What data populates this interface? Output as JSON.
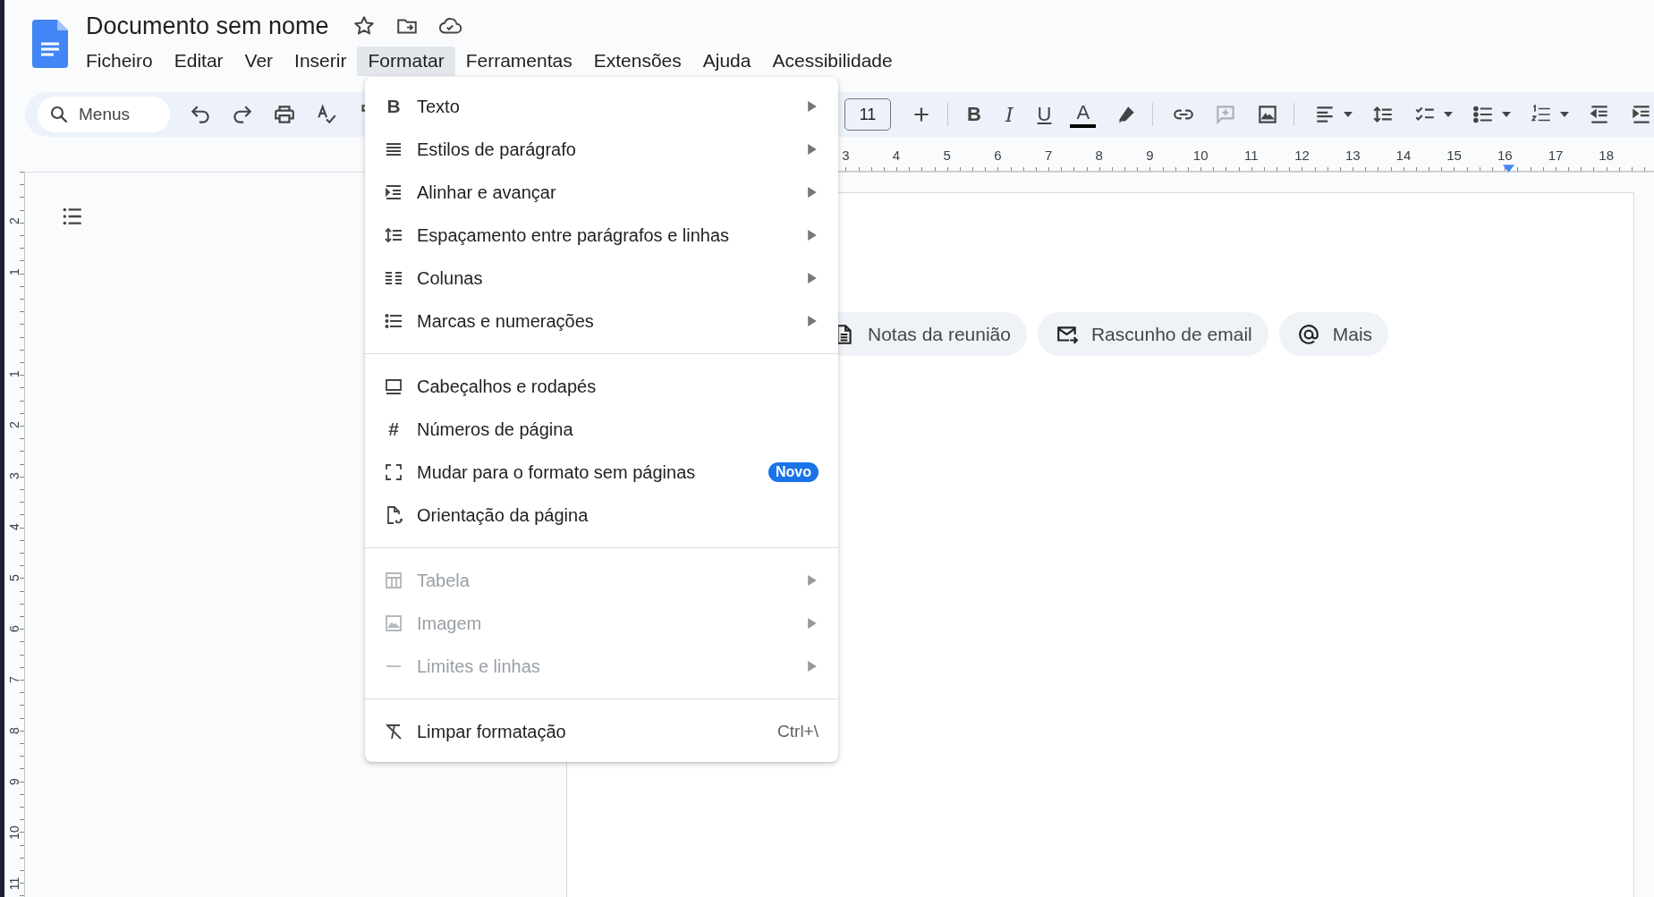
{
  "document": {
    "title": "Documento sem nome"
  },
  "menubar": [
    {
      "label": "Ficheiro",
      "selected": false
    },
    {
      "label": "Editar",
      "selected": false
    },
    {
      "label": "Ver",
      "selected": false
    },
    {
      "label": "Inserir",
      "selected": false
    },
    {
      "label": "Formatar",
      "selected": true
    },
    {
      "label": "Ferramentas",
      "selected": false
    },
    {
      "label": "Extensões",
      "selected": false
    },
    {
      "label": "Ajuda",
      "selected": false
    },
    {
      "label": "Acessibilidade",
      "selected": false
    }
  ],
  "toolbar": {
    "search": {
      "placeholder": "Menus"
    },
    "font_size": "11",
    "text_buttons": [
      {
        "glyph": "B",
        "kind": "bold"
      },
      {
        "glyph": "I",
        "kind": "italic"
      },
      {
        "glyph": "U",
        "kind": "underline"
      },
      {
        "glyph": "A",
        "kind": "color"
      }
    ]
  },
  "horizontal_ruler": [
    "3",
    "4",
    "5",
    "6",
    "7",
    "8",
    "9",
    "10",
    "11",
    "12",
    "13",
    "14",
    "15",
    "16",
    "17",
    "18"
  ],
  "vertical_ruler": {
    "above": [
      "2",
      "1"
    ],
    "below": [
      "1",
      "2",
      "3",
      "4",
      "5",
      "6",
      "7",
      "8",
      "9",
      "10",
      "11"
    ]
  },
  "chips": [
    {
      "label": "Notas da reunião"
    },
    {
      "label": "Rascunho de email"
    },
    {
      "label": "Mais"
    }
  ],
  "format_menu": {
    "sections": [
      [
        {
          "label": "Texto",
          "kind": "submenu",
          "disabled": false,
          "glyph": "B"
        },
        {
          "label": "Estilos de parágrafo",
          "kind": "submenu",
          "disabled": false
        },
        {
          "label": "Alinhar e avançar",
          "kind": "submenu",
          "disabled": false
        },
        {
          "label": "Espaçamento entre parágrafos e linhas",
          "kind": "submenu",
          "disabled": false
        },
        {
          "label": "Colunas",
          "kind": "submenu",
          "disabled": false
        },
        {
          "label": "Marcas e numerações",
          "kind": "submenu",
          "disabled": false
        }
      ],
      [
        {
          "label": "Cabeçalhos e rodapés",
          "kind": "action",
          "disabled": false
        },
        {
          "label": "Números de página",
          "kind": "action",
          "disabled": false,
          "glyph": "#"
        },
        {
          "label": "Mudar para o formato sem páginas",
          "kind": "action",
          "disabled": false,
          "badge": "Novo"
        },
        {
          "label": "Orientação da página",
          "kind": "action",
          "disabled": false
        }
      ],
      [
        {
          "label": "Tabela",
          "kind": "submenu",
          "disabled": true
        },
        {
          "label": "Imagem",
          "kind": "submenu",
          "disabled": true
        },
        {
          "label": "Limites e linhas",
          "kind": "submenu",
          "disabled": true
        }
      ],
      [
        {
          "label": "Limpar formatação",
          "kind": "action",
          "disabled": false,
          "shortcut": "Ctrl+\\"
        }
      ]
    ]
  }
}
